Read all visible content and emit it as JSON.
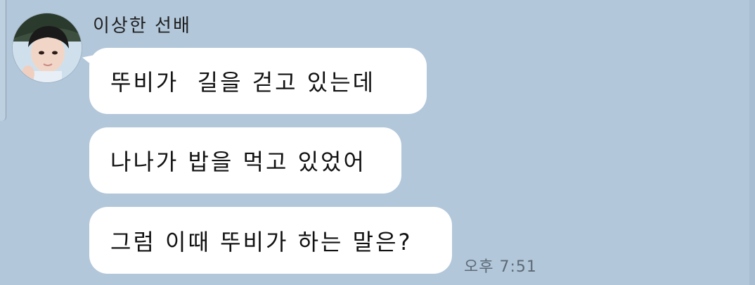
{
  "chat": {
    "sender": {
      "name": "이상한 선배",
      "avatar_icon": "profile-photo"
    },
    "messages": [
      {
        "text": "뚜비가  길을 걷고 있는데"
      },
      {
        "text": "나나가 밥을 먹고 있었어"
      },
      {
        "text": "그럼 이때 뚜비가 하는 말은?"
      }
    ],
    "timestamp": "오후 7:51"
  },
  "colors": {
    "background": "#b2c7da",
    "bubble": "#ffffff",
    "text": "#111111",
    "timestamp": "#5d6a77"
  }
}
